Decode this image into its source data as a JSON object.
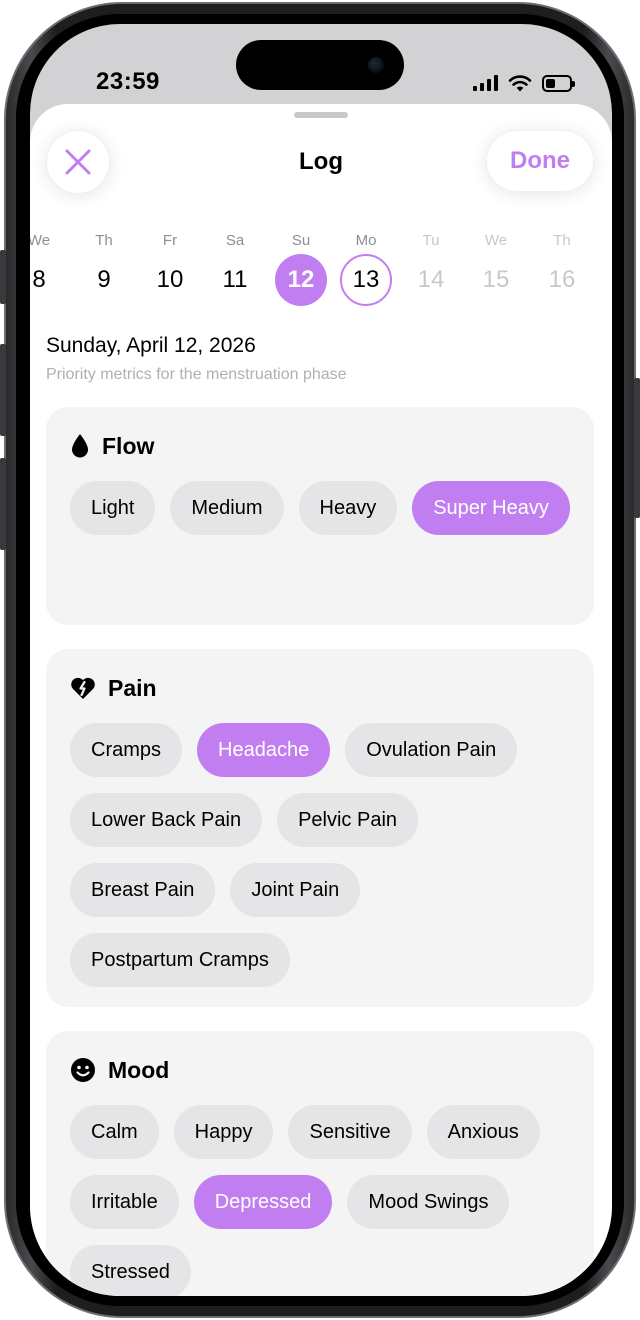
{
  "status": {
    "time": "23:59"
  },
  "sheet": {
    "title": "Log",
    "done_label": "Done"
  },
  "colors": {
    "accent": "#c17ef0",
    "chip": "#e5e5e7",
    "card": "#f4f4f5"
  },
  "week": [
    {
      "weekday": "We",
      "day": "8",
      "state": "past"
    },
    {
      "weekday": "Th",
      "day": "9",
      "state": "past"
    },
    {
      "weekday": "Fr",
      "day": "10",
      "state": "past"
    },
    {
      "weekday": "Sa",
      "day": "11",
      "state": "past"
    },
    {
      "weekday": "Su",
      "day": "12",
      "state": "selected"
    },
    {
      "weekday": "Mo",
      "day": "13",
      "state": "today"
    },
    {
      "weekday": "Tu",
      "day": "14",
      "state": "future"
    },
    {
      "weekday": "We",
      "day": "15",
      "state": "future"
    },
    {
      "weekday": "Th",
      "day": "16",
      "state": "future"
    }
  ],
  "date": {
    "heading": "Sunday, April 12, 2026",
    "subtitle": "Priority metrics for the menstruation phase"
  },
  "sections": [
    {
      "title": "Flow",
      "icon": "drop-icon",
      "options": [
        {
          "label": "Light",
          "selected": false
        },
        {
          "label": "Medium",
          "selected": false
        },
        {
          "label": "Heavy",
          "selected": false
        },
        {
          "label": "Super Heavy",
          "selected": true
        }
      ]
    },
    {
      "title": "Pain",
      "icon": "broken-heart-icon",
      "options": [
        {
          "label": "Cramps",
          "selected": false
        },
        {
          "label": "Headache",
          "selected": true
        },
        {
          "label": "Ovulation Pain",
          "selected": false
        },
        {
          "label": "Lower Back Pain",
          "selected": false
        },
        {
          "label": "Pelvic Pain",
          "selected": false
        },
        {
          "label": "Breast Pain",
          "selected": false
        },
        {
          "label": "Joint Pain",
          "selected": false
        },
        {
          "label": "Postpartum Cramps",
          "selected": false
        }
      ]
    },
    {
      "title": "Mood",
      "icon": "smiley-icon",
      "options": [
        {
          "label": "Calm",
          "selected": false
        },
        {
          "label": "Happy",
          "selected": false
        },
        {
          "label": "Sensitive",
          "selected": false
        },
        {
          "label": "Anxious",
          "selected": false
        },
        {
          "label": "Irritable",
          "selected": false
        },
        {
          "label": "Depressed",
          "selected": true
        },
        {
          "label": "Mood Swings",
          "selected": false
        },
        {
          "label": "Stressed",
          "selected": false
        }
      ]
    }
  ]
}
